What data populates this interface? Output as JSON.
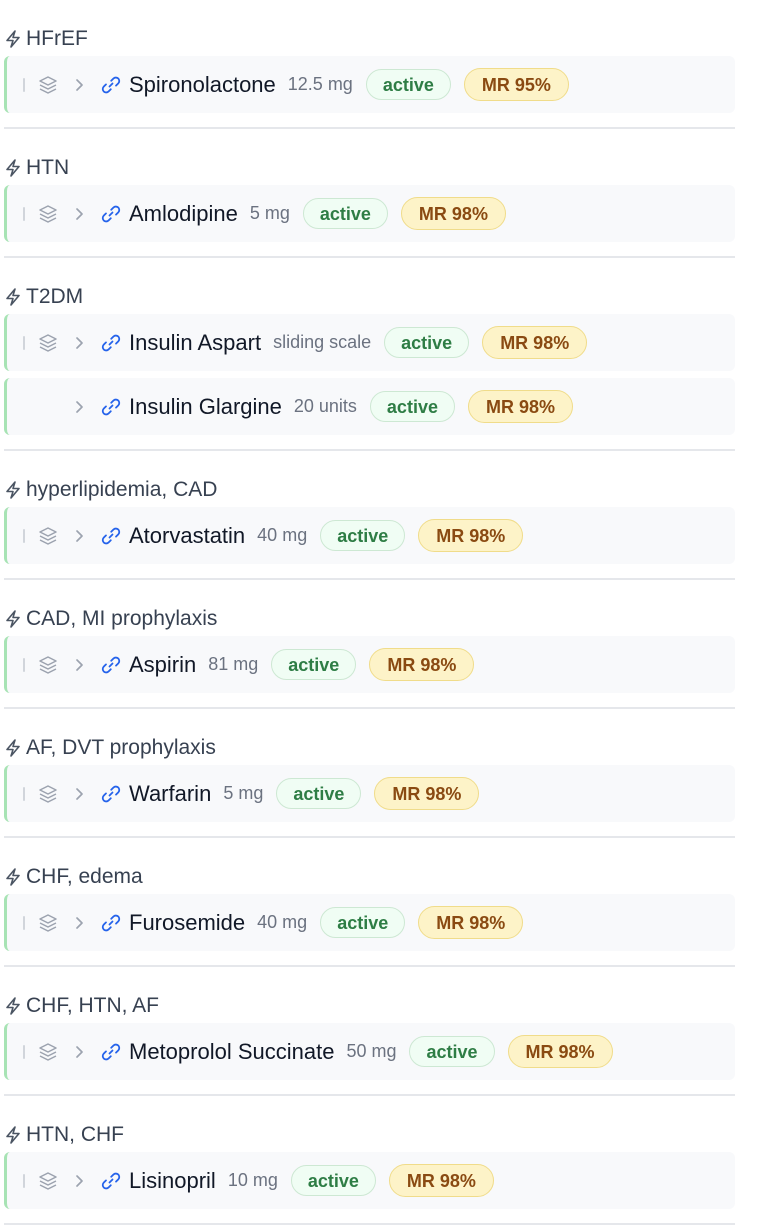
{
  "groups": [
    {
      "indication": "HFrEF",
      "meds": [
        {
          "name": "Spironolactone",
          "dose": "12.5 mg",
          "status": "active",
          "match": "MR 95%",
          "has_layers": true
        }
      ]
    },
    {
      "indication": "HTN",
      "meds": [
        {
          "name": "Amlodipine",
          "dose": "5 mg",
          "status": "active",
          "match": "MR 98%",
          "has_layers": true
        }
      ]
    },
    {
      "indication": "T2DM",
      "meds": [
        {
          "name": "Insulin Aspart",
          "dose": "sliding scale",
          "status": "active",
          "match": "MR 98%",
          "has_layers": true
        },
        {
          "name": "Insulin Glargine",
          "dose": "20 units",
          "status": "active",
          "match": "MR 98%",
          "has_layers": false
        }
      ]
    },
    {
      "indication": "hyperlipidemia, CAD",
      "meds": [
        {
          "name": "Atorvastatin",
          "dose": "40 mg",
          "status": "active",
          "match": "MR 98%",
          "has_layers": true
        }
      ]
    },
    {
      "indication": "CAD, MI prophylaxis",
      "meds": [
        {
          "name": "Aspirin",
          "dose": "81 mg",
          "status": "active",
          "match": "MR 98%",
          "has_layers": true
        }
      ]
    },
    {
      "indication": "AF, DVT prophylaxis",
      "meds": [
        {
          "name": "Warfarin",
          "dose": "5 mg",
          "status": "active",
          "match": "MR 98%",
          "has_layers": true
        }
      ]
    },
    {
      "indication": "CHF, edema",
      "meds": [
        {
          "name": "Furosemide",
          "dose": "40 mg",
          "status": "active",
          "match": "MR 98%",
          "has_layers": true
        }
      ]
    },
    {
      "indication": "CHF, HTN, AF",
      "meds": [
        {
          "name": "Metoprolol Succinate",
          "dose": "50 mg",
          "status": "active",
          "match": "MR 98%",
          "has_layers": true
        }
      ]
    },
    {
      "indication": "HTN, CHF",
      "meds": [
        {
          "name": "Lisinopril",
          "dose": "10 mg",
          "status": "active",
          "match": "MR 98%",
          "has_layers": true
        }
      ]
    }
  ],
  "icons": {
    "group_header": "bolt-icon",
    "group_toggle": "layers-icon",
    "expand": "chevron-right-icon",
    "reference": "link-icon"
  },
  "colors": {
    "status_text": "#2e7d45",
    "status_bg": "#f0fdf4",
    "match_text": "#8a4a12",
    "match_bg": "#fdf3c8",
    "row_accent": "#a7e3b4",
    "link": "#2563eb"
  }
}
